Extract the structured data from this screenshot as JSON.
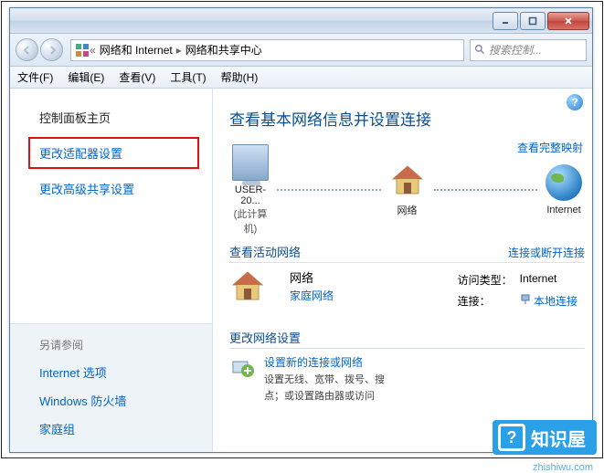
{
  "titlebar": {
    "min": "—",
    "max": "▢",
    "close": "×"
  },
  "breadcrumb": {
    "root_icon": "control-panel-icon",
    "seg1": "网络和 Internet",
    "seg2": "网络和共享中心"
  },
  "search": {
    "placeholder": "搜索控制..."
  },
  "menu": {
    "file": "文件(F)",
    "edit": "编辑(E)",
    "view": "查看(V)",
    "tools": "工具(T)",
    "help": "帮助(H)"
  },
  "sidebar": {
    "home": "控制面板主页",
    "adapter": "更改适配器设置",
    "advshare": "更改高级共享设置",
    "seealso": "另请参阅",
    "links": [
      "Internet 选项",
      "Windows 防火墙",
      "家庭组"
    ]
  },
  "content": {
    "title": "查看基本网络信息并设置连接",
    "maplink": "查看完整映射",
    "nodes": {
      "pc": "USER-20...",
      "pc_sub": "(此计算机)",
      "net": "网络",
      "internet": "Internet"
    },
    "active_hdr": "查看活动网络",
    "active_link": "连接或断开连接",
    "network": {
      "name": "网络",
      "type": "家庭网络"
    },
    "kv": {
      "access_lbl": "访问类型：",
      "access_val": "Internet",
      "conn_lbl": "连接：",
      "conn_val": "本地连接"
    },
    "change_hdr": "更改网络设置",
    "setup": {
      "title": "设置新的连接或网络",
      "desc": "设置无线、宽带、拨号、搜",
      "desc2": "点；或设置路由器或访问"
    }
  },
  "watermark": {
    "text": "知识屋",
    "url": "zhishiwu.com"
  }
}
